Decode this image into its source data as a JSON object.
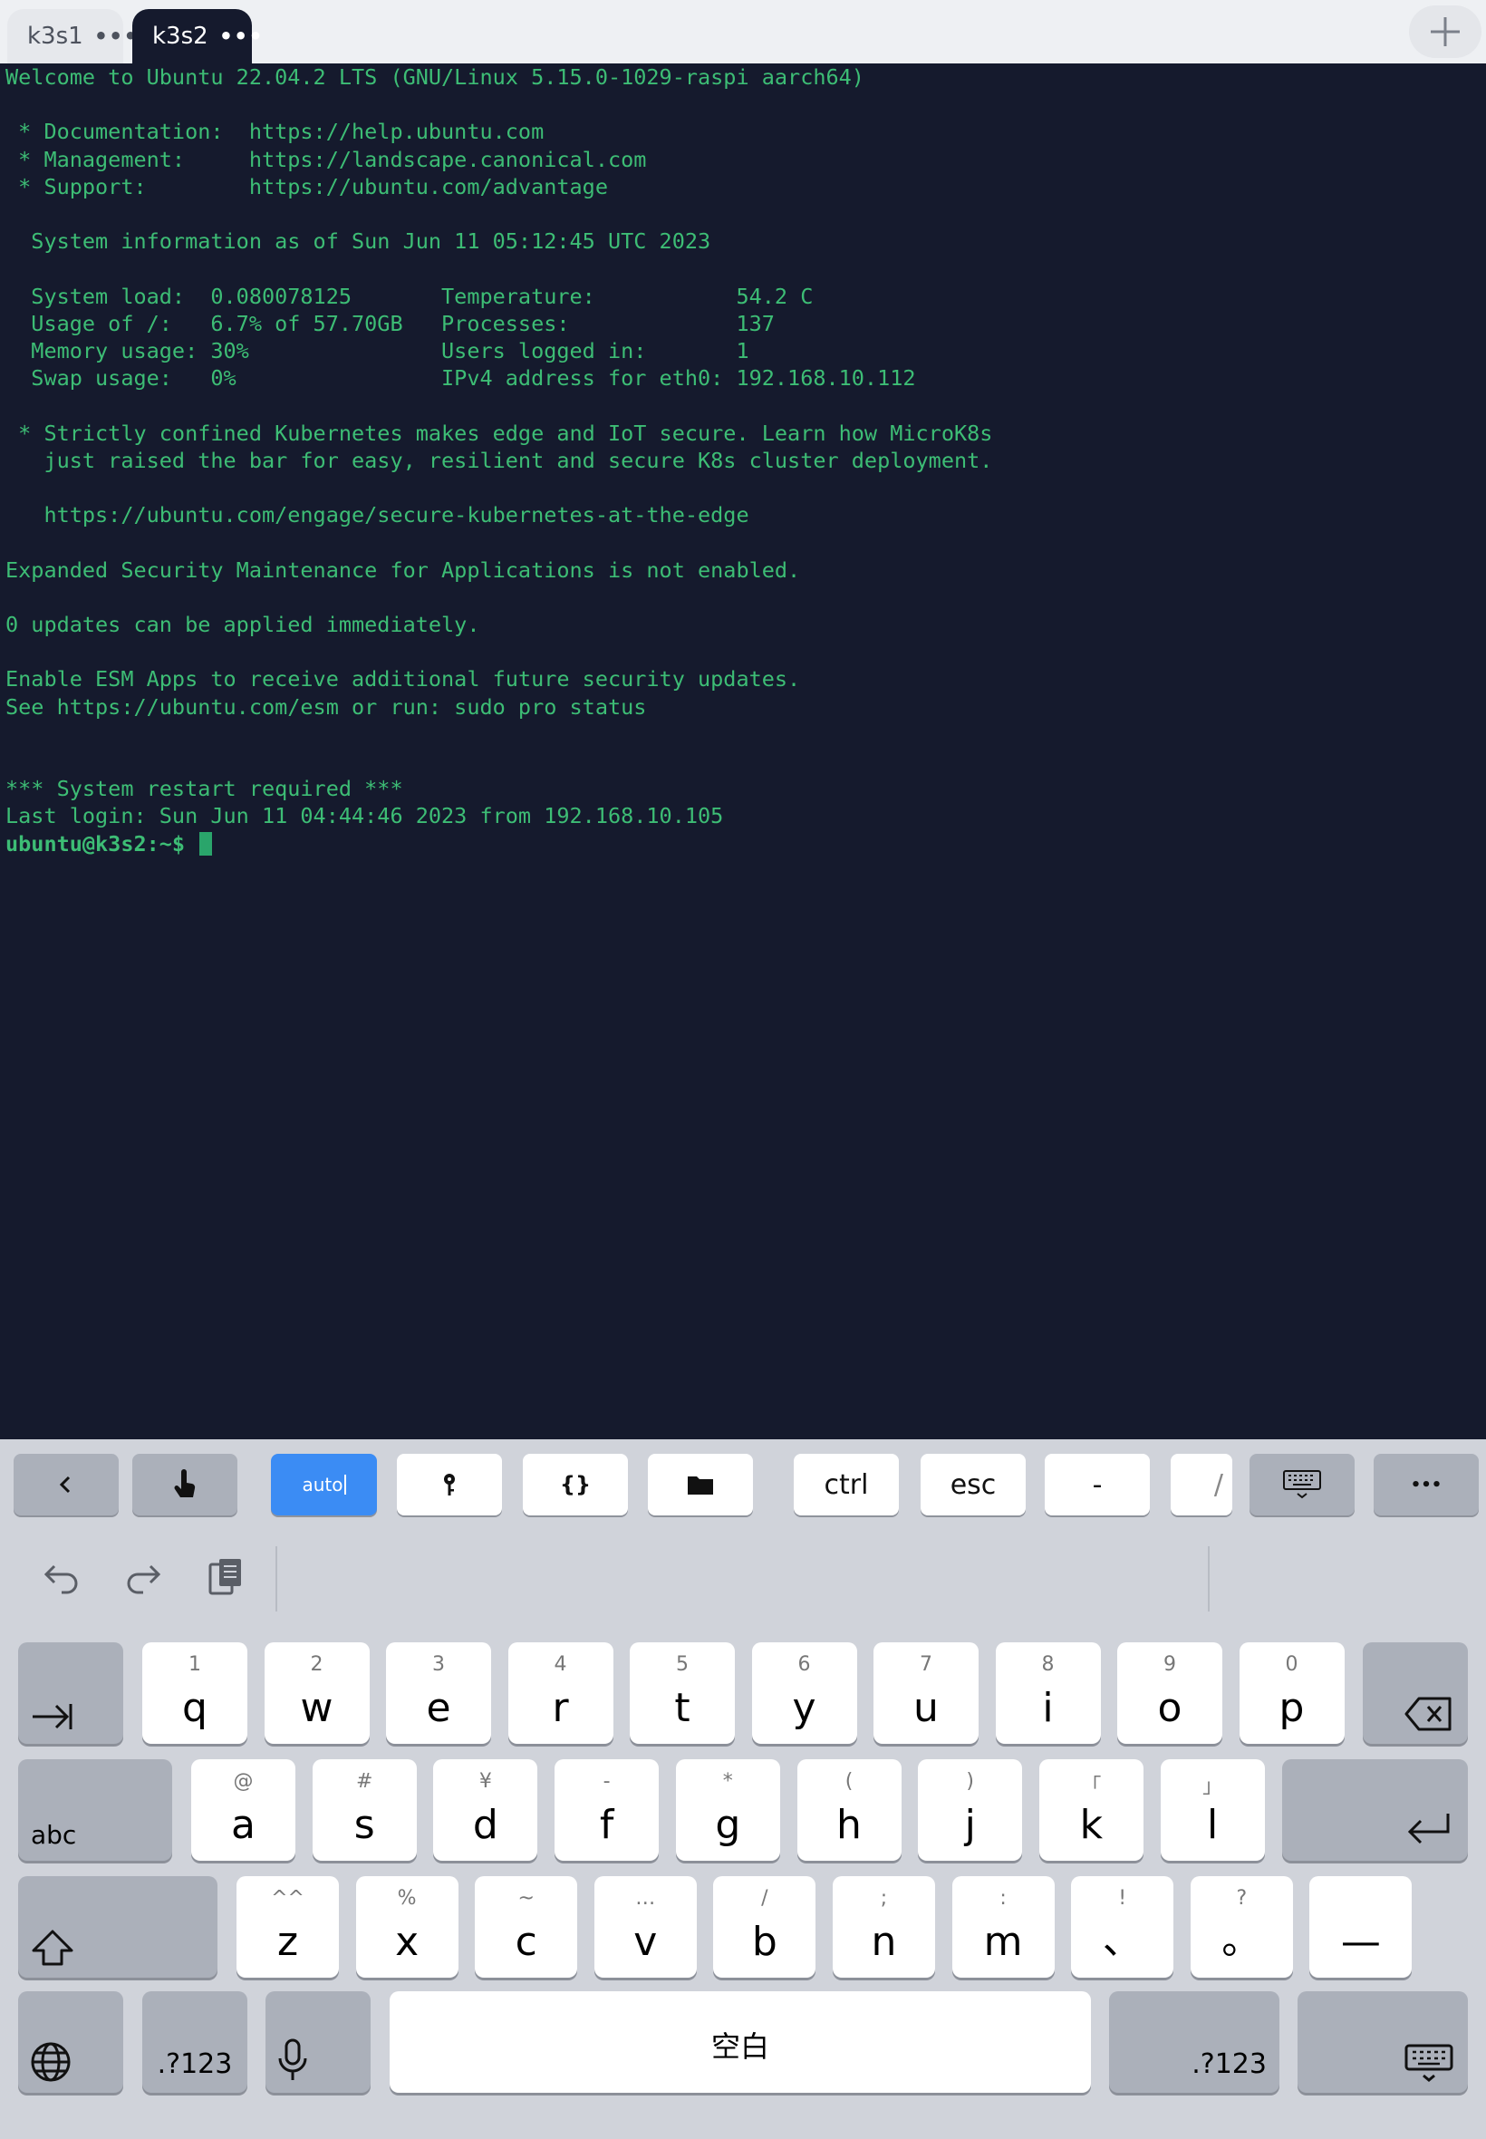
{
  "tabs": [
    {
      "label": "k3s1",
      "active": false
    },
    {
      "label": "k3s2",
      "active": true
    }
  ],
  "terminal": {
    "lines": [
      "Welcome to Ubuntu 22.04.2 LTS (GNU/Linux 5.15.0-1029-raspi aarch64)",
      "",
      " * Documentation:  https://help.ubuntu.com",
      " * Management:     https://landscape.canonical.com",
      " * Support:        https://ubuntu.com/advantage",
      "",
      "  System information as of Sun Jun 11 05:12:45 UTC 2023",
      "",
      "  System load:  0.080078125       Temperature:           54.2 C",
      "  Usage of /:   6.7% of 57.70GB   Processes:             137",
      "  Memory usage: 30%               Users logged in:       1",
      "  Swap usage:   0%                IPv4 address for eth0: 192.168.10.112",
      "",
      " * Strictly confined Kubernetes makes edge and IoT secure. Learn how MicroK8s",
      "   just raised the bar for easy, resilient and secure K8s cluster deployment.",
      "",
      "   https://ubuntu.com/engage/secure-kubernetes-at-the-edge",
      "",
      "Expanded Security Maintenance for Applications is not enabled.",
      "",
      "0 updates can be applied immediately.",
      "",
      "Enable ESM Apps to receive additional future security updates.",
      "See https://ubuntu.com/esm or run: sudo pro status",
      "",
      "",
      "*** System restart required ***",
      "Last login: Sun Jun 11 04:44:46 2023 from 192.168.10.105"
    ],
    "prompt": "ubuntu@k3s2:~$ "
  },
  "accessory": {
    "auto": "auto",
    "ctrl": "ctrl",
    "esc": "esc",
    "dash": "-",
    "slash": "/",
    "more": "•••"
  },
  "keys": {
    "row1": [
      {
        "main": "q",
        "sub": "1"
      },
      {
        "main": "w",
        "sub": "2"
      },
      {
        "main": "e",
        "sub": "3"
      },
      {
        "main": "r",
        "sub": "4"
      },
      {
        "main": "t",
        "sub": "5"
      },
      {
        "main": "y",
        "sub": "6"
      },
      {
        "main": "u",
        "sub": "7"
      },
      {
        "main": "i",
        "sub": "8"
      },
      {
        "main": "o",
        "sub": "9"
      },
      {
        "main": "p",
        "sub": "0"
      }
    ],
    "row2": [
      {
        "main": "a",
        "sub": "@"
      },
      {
        "main": "s",
        "sub": "#"
      },
      {
        "main": "d",
        "sub": "¥"
      },
      {
        "main": "f",
        "sub": "-"
      },
      {
        "main": "g",
        "sub": "*"
      },
      {
        "main": "h",
        "sub": "("
      },
      {
        "main": "j",
        "sub": ")"
      },
      {
        "main": "k",
        "sub": "「"
      },
      {
        "main": "l",
        "sub": "」"
      }
    ],
    "row3": [
      {
        "main": "z",
        "sub": "^^"
      },
      {
        "main": "x",
        "sub": "%"
      },
      {
        "main": "c",
        "sub": "~"
      },
      {
        "main": "v",
        "sub": "…"
      },
      {
        "main": "b",
        "sub": "/"
      },
      {
        "main": "n",
        "sub": ";"
      },
      {
        "main": "m",
        "sub": ":"
      },
      {
        "main": "、",
        "sub": "!"
      },
      {
        "main": "。",
        "sub": "?"
      },
      {
        "main": "—",
        "sub": ""
      }
    ],
    "abc": "abc",
    "num_left": ".?123",
    "num_right": ".?123",
    "space": "空白"
  }
}
